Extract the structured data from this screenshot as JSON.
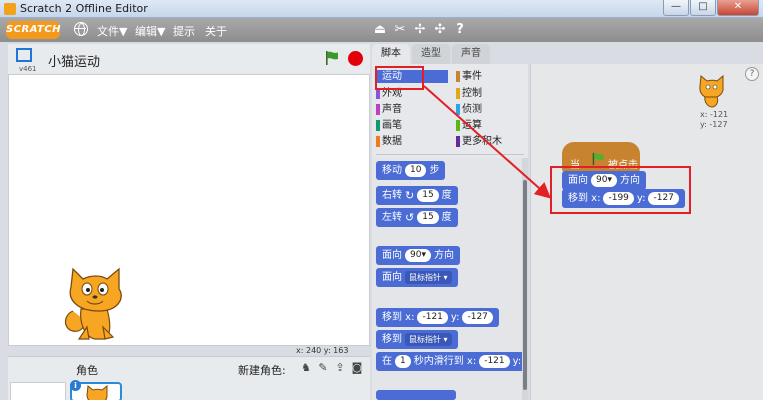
{
  "window": {
    "title": "Scratch 2 Offline Editor",
    "buttons": [
      "—",
      "□",
      "✕"
    ]
  },
  "menubar": {
    "logo": "SCRATCH",
    "items": [
      "文件▼",
      "编辑▼",
      "提示",
      "关于"
    ],
    "tool_icons": [
      "copy-icon",
      "cut-icon",
      "grow-icon",
      "shrink-icon",
      "help-icon"
    ]
  },
  "stage": {
    "version": "v461",
    "sprite_name": "小猫运动",
    "mouse_coords": "x: 240  y: 163"
  },
  "sprite_panel": {
    "label": "角色",
    "new_sprite": "新建角色:"
  },
  "tabs": [
    "脚本",
    "造型",
    "声音"
  ],
  "categories": [
    {
      "label": "运动",
      "color": "#4a6cd4",
      "selected": true
    },
    {
      "label": "事件",
      "color": "#c88330"
    },
    {
      "label": "外观",
      "color": "#8a55d7"
    },
    {
      "label": "控制",
      "color": "#e1a91a"
    },
    {
      "label": "声音",
      "color": "#bb42c3"
    },
    {
      "label": "侦测",
      "color": "#2ca5e2"
    },
    {
      "label": "画笔",
      "color": "#0e9a6c"
    },
    {
      "label": "运算",
      "color": "#5cb712"
    },
    {
      "label": "数据",
      "color": "#ee7d16"
    },
    {
      "label": "更多积木",
      "color": "#632d99"
    }
  ],
  "blocks": {
    "move": [
      "移动",
      "10",
      "步"
    ],
    "turn_right": [
      "右转",
      "↻",
      "15",
      "度"
    ],
    "turn_left": [
      "左转",
      "↺",
      "15",
      "度"
    ],
    "point_dir": [
      "面向",
      "90▾",
      "方向"
    ],
    "point_towards": [
      "面向",
      "鼠标指针 ▾"
    ],
    "goto_xy": [
      "移到 x:",
      "-121",
      "y:",
      "-127"
    ],
    "goto": [
      "移到",
      "鼠标指针 ▾"
    ],
    "glide": [
      "在",
      "1",
      "秒内滑行到 x:",
      "-121",
      "y:"
    ]
  },
  "script": {
    "hat": [
      "当",
      "被点击"
    ],
    "point_dir": [
      "面向",
      "90▾",
      "方向"
    ],
    "goto_xy": [
      "移到 x:",
      "-199",
      "y:",
      "-127"
    ],
    "sprite_coords": [
      "x: -121",
      "y: -127"
    ]
  },
  "colors": {
    "motion": "#4a6cd4",
    "events": "#c88330",
    "annotation": "#e31f26",
    "flag": "#3a9b2b",
    "stop": "#e4000a"
  }
}
